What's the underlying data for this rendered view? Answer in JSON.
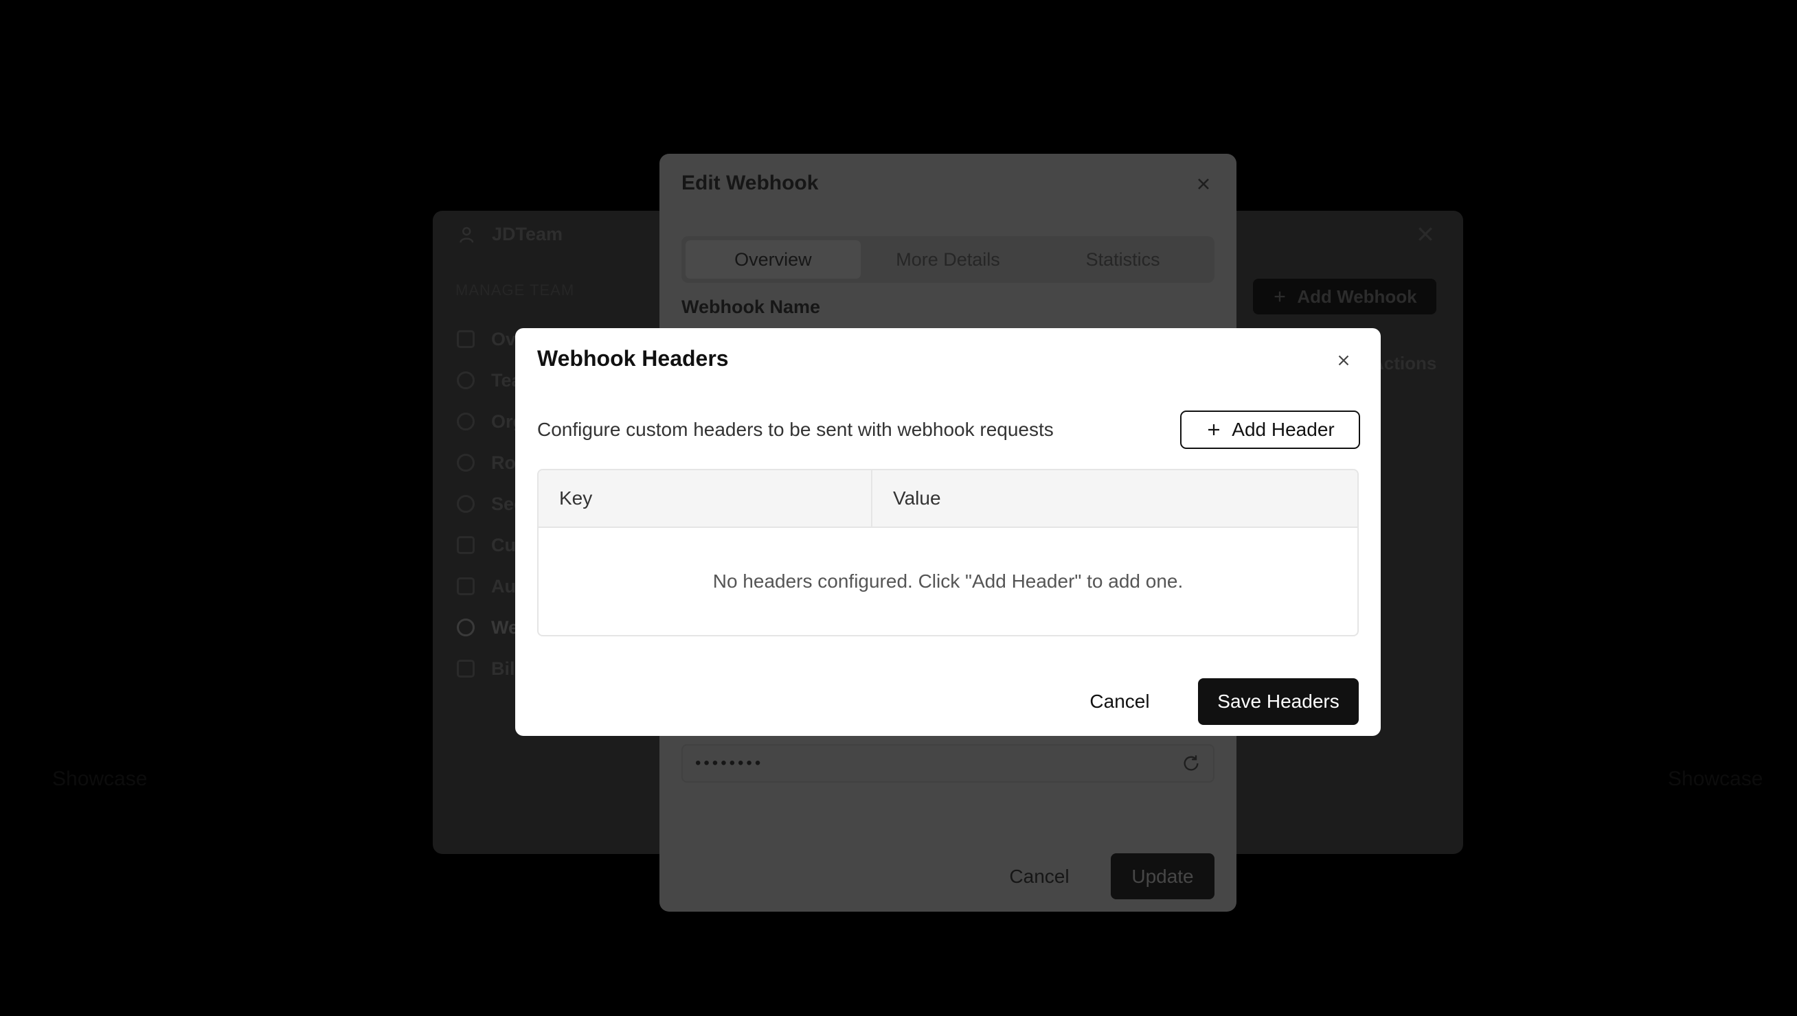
{
  "background_page": {
    "section_left_label": "Showcase",
    "section_right_label": "Showcase"
  },
  "team_panel": {
    "team_name": "JDTeam",
    "section_label": "MANAGE TEAM",
    "nav_items": [
      {
        "label": "Overview",
        "icon": "grid-icon"
      },
      {
        "label": "Teams",
        "icon": "user-icon"
      },
      {
        "label": "Organizations",
        "icon": "users-icon"
      },
      {
        "label": "Roles",
        "icon": "circle-icon"
      },
      {
        "label": "Security",
        "icon": "gear-icon"
      },
      {
        "label": "Custom Fields",
        "icon": "sliders-icon"
      },
      {
        "label": "Audit Log",
        "icon": "list-icon"
      },
      {
        "label": "Webhooks",
        "icon": "webhook-icon"
      },
      {
        "label": "Billing",
        "icon": "card-icon"
      }
    ],
    "active_nav": "Webhooks",
    "add_webhook_label": "Add Webhook",
    "column_actions_label": "Actions"
  },
  "edit_webhook_modal": {
    "title": "Edit Webhook",
    "tabs": [
      "Overview",
      "More Details",
      "Statistics"
    ],
    "active_tab": "Overview",
    "name_label": "Webhook Name",
    "secret_mask": "••••••••",
    "cancel_label": "Cancel",
    "update_label": "Update"
  },
  "headers_modal": {
    "title": "Webhook Headers",
    "description": "Configure custom headers to be sent with webhook requests",
    "add_header_label": "Add Header",
    "table": {
      "columns": [
        "Key",
        "Value"
      ],
      "rows": [],
      "empty_message": "No headers configured. Click \"Add Header\" to add one."
    },
    "cancel_label": "Cancel",
    "save_label": "Save Headers"
  },
  "colors": {
    "primary": "#111111",
    "overlay": "#000000",
    "modal_bg": "#ffffff",
    "table_header_bg": "#f5f5f5",
    "border": "#e5e5e5"
  }
}
